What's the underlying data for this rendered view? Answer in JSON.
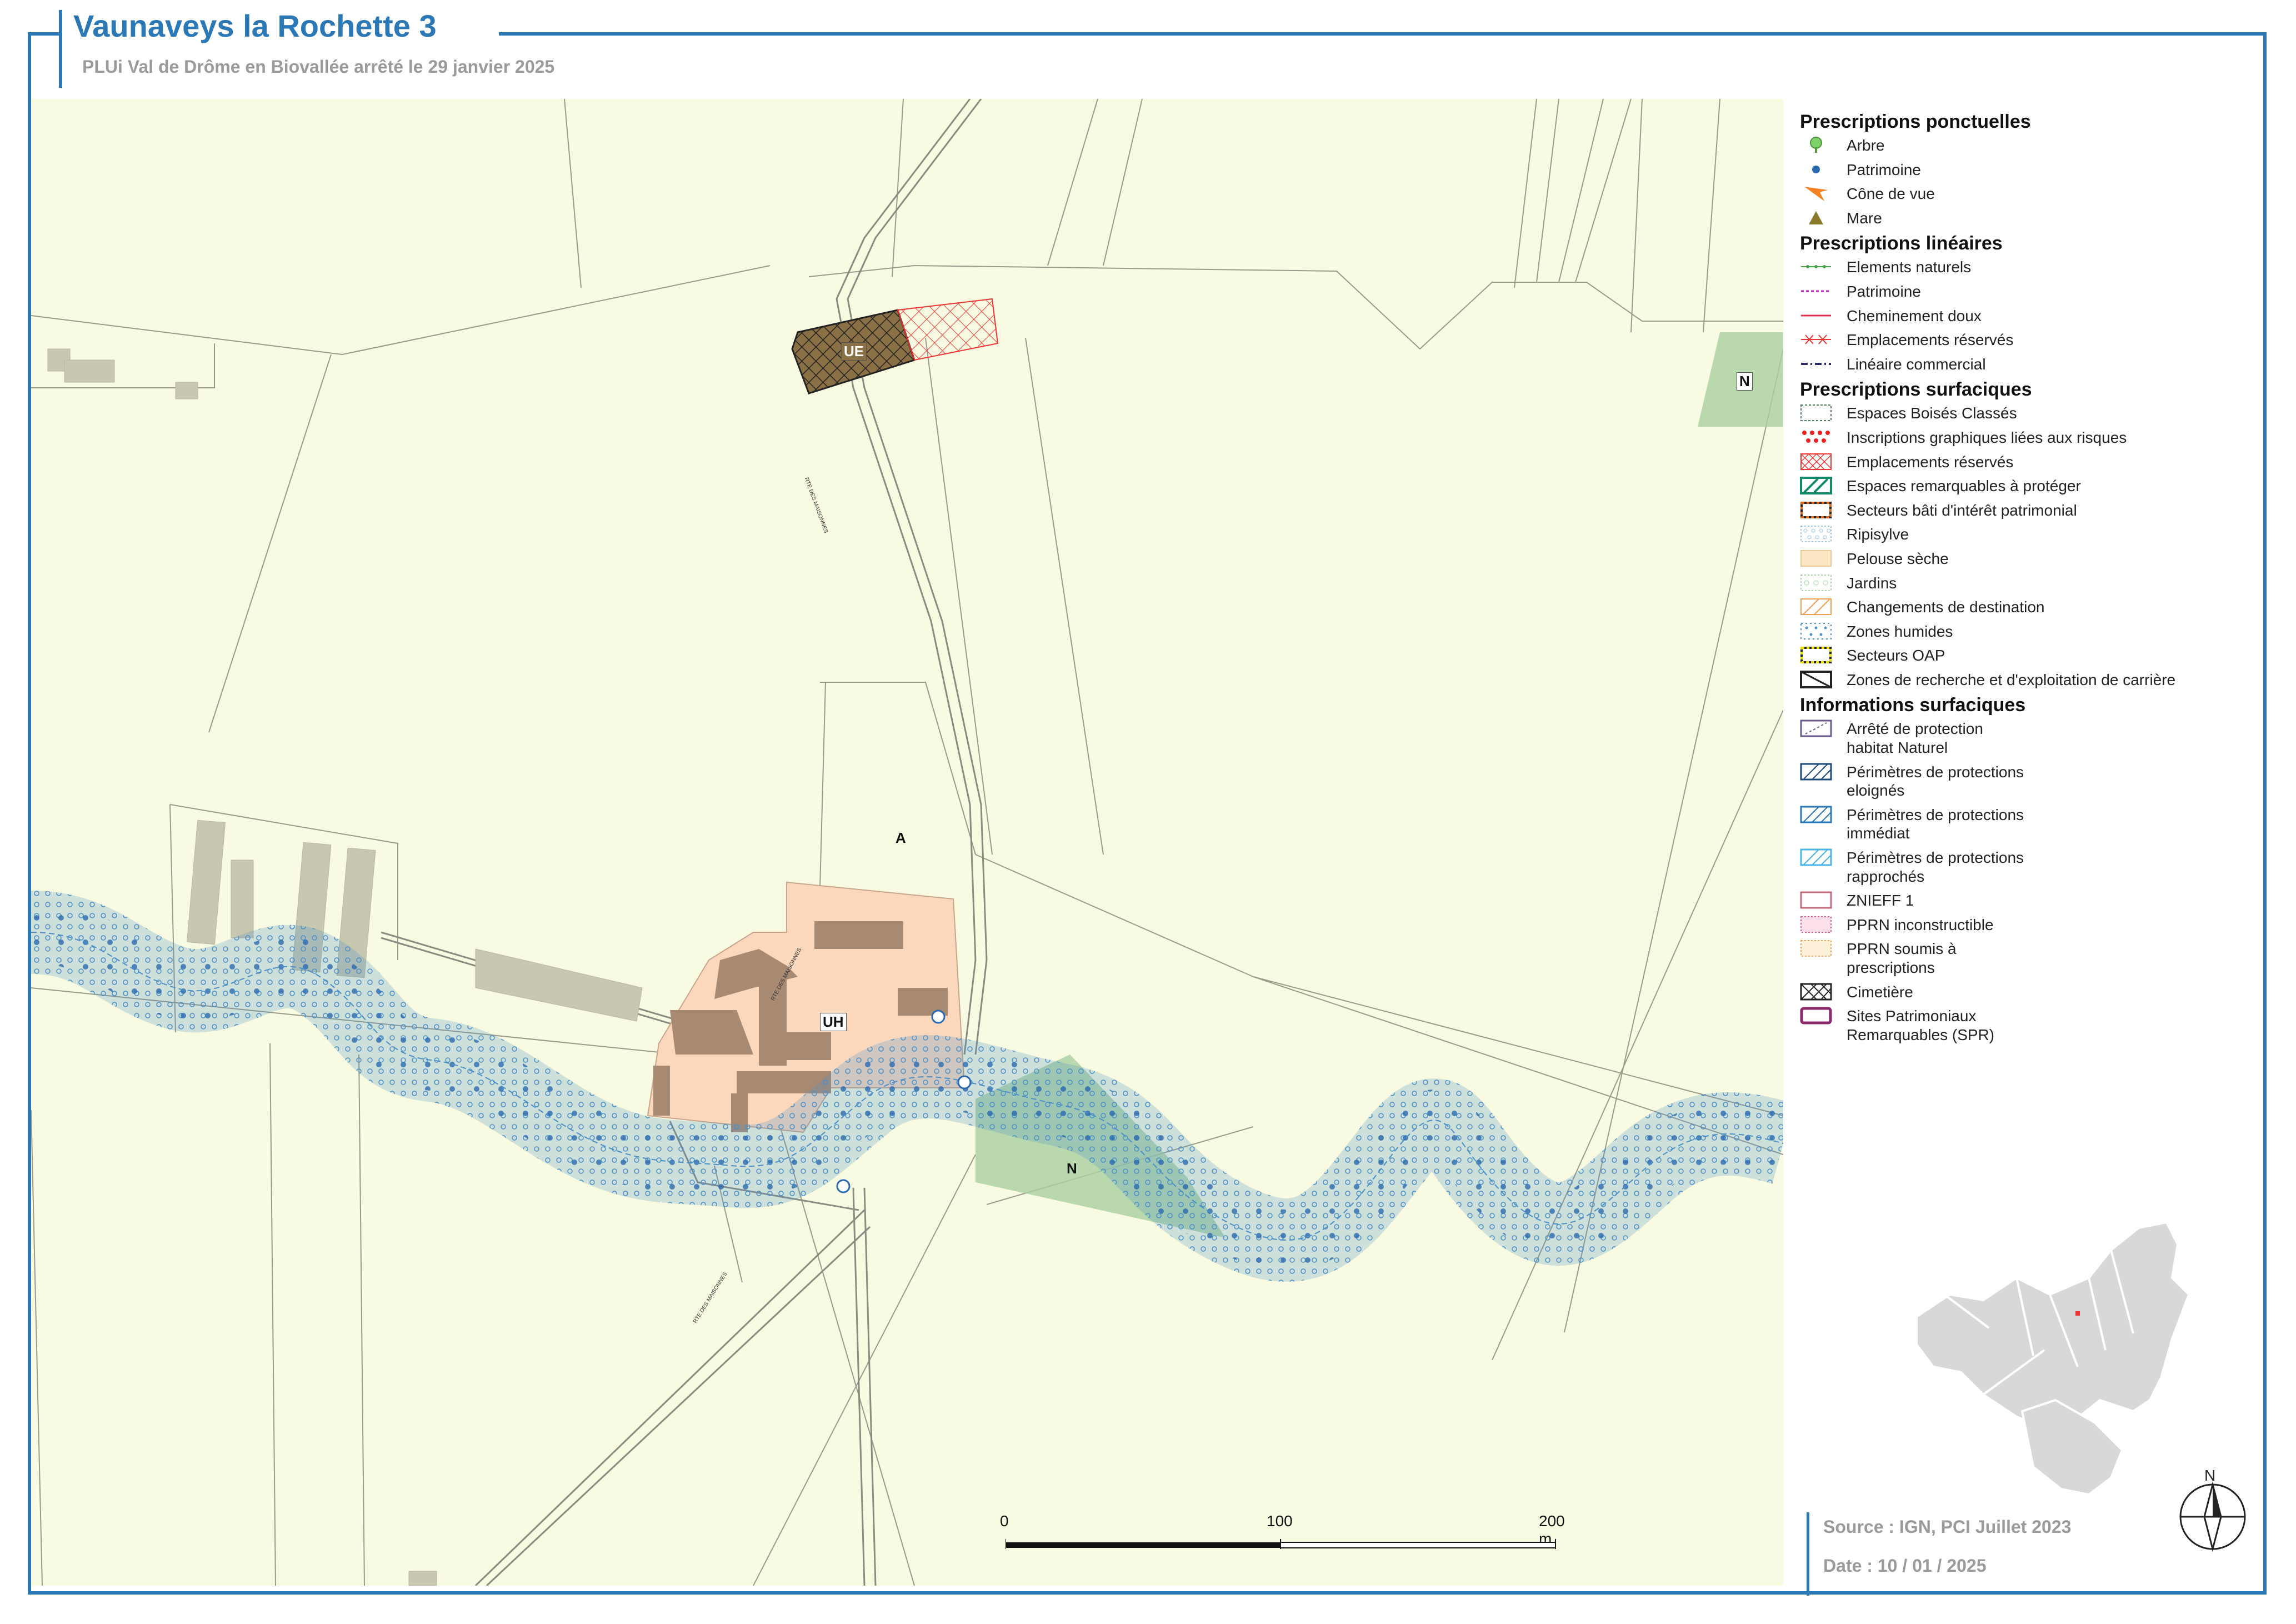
{
  "header": {
    "title": "Vaunaveys la Rochette 3",
    "subtitle": "PLUi Val de Drôme en Biovallée arrêté le 29 janvier 2025"
  },
  "map": {
    "zones": {
      "ue": "UE",
      "uh": "UH",
      "a": "A",
      "n1": "N",
      "n2": "N"
    },
    "roads": [
      "RTE DES MAISONNES",
      "RTE DES MAISONNES",
      "RTE DES MAISONNES"
    ]
  },
  "legend": {
    "sections": [
      {
        "title": "Prescriptions ponctuelles",
        "items": [
          {
            "label": "Arbre",
            "icon": "tree-icon"
          },
          {
            "label": "Patrimoine",
            "icon": "dot-icon"
          },
          {
            "label": "Cône de vue",
            "icon": "view-cone-icon"
          },
          {
            "label": "Mare",
            "icon": "triangle-icon"
          }
        ]
      },
      {
        "title": "Prescriptions linéaires",
        "items": [
          {
            "label": "Elements naturels",
            "icon": "line-green-dots"
          },
          {
            "label": "Patrimoine",
            "icon": "line-magenta-dash"
          },
          {
            "label": "Cheminement doux",
            "icon": "line-red"
          },
          {
            "label": "Emplacements réservés",
            "icon": "line-red-cross"
          },
          {
            "label": "Linéaire commercial",
            "icon": "line-navy-dashdot"
          }
        ]
      },
      {
        "title": "Prescriptions surfaciques",
        "items": [
          {
            "label": "Espaces Boisés Classés",
            "icon": "box-ebc"
          },
          {
            "label": "Inscriptions graphiques liées aux risques",
            "icon": "box-red-dots"
          },
          {
            "label": "Emplacements réservés",
            "icon": "box-red-hatch"
          },
          {
            "label": "Espaces remarquables à protéger",
            "icon": "box-green-diag"
          },
          {
            "label": "Secteurs bâti d'intérêt patrimonial",
            "icon": "box-orange-dash"
          },
          {
            "label": "Ripisylve",
            "icon": "box-blue-circles"
          },
          {
            "label": "Pelouse sèche",
            "icon": "box-tan-dots"
          },
          {
            "label": "Jardins",
            "icon": "box-green-circles"
          },
          {
            "label": "Changements de destination",
            "icon": "box-orange-hatch"
          },
          {
            "label": "Zones humides",
            "icon": "box-blue-dots"
          },
          {
            "label": "Secteurs OAP",
            "icon": "box-yellow-dash"
          },
          {
            "label": "Zones de recherche et d'exploitation de carrière",
            "icon": "box-black-diag"
          }
        ]
      },
      {
        "title": "Informations surfaciques",
        "items": [
          {
            "label": "Arrêté de protection habitat Naturel",
            "icon": "box-purple-dash"
          },
          {
            "label": "Périmètres de protections eloignés",
            "icon": "box-navy-hatch"
          },
          {
            "label": "Périmètres de protections immédiat",
            "icon": "box-blue-hatch"
          },
          {
            "label": "Périmètres de protections rapprochés",
            "icon": "box-cyan-hatch"
          },
          {
            "label": "ZNIEFF 1",
            "icon": "box-rose"
          },
          {
            "label": "PPRN inconstructible",
            "icon": "box-pink-dots"
          },
          {
            "label": "PPRN soumis à prescriptions",
            "icon": "box-orange-dots"
          },
          {
            "label": "Cimetière",
            "icon": "box-cross-hatch"
          },
          {
            "label": "Sites Patrimoniaux Remarquables (SPR)",
            "icon": "box-spr"
          }
        ]
      }
    ]
  },
  "scale": {
    "ticks": [
      "0",
      "100",
      "200 m"
    ]
  },
  "north": "N",
  "footer": {
    "source": "Source : IGN, PCI Juillet 2023",
    "date": "Date : 10 / 01 / 2025"
  }
}
